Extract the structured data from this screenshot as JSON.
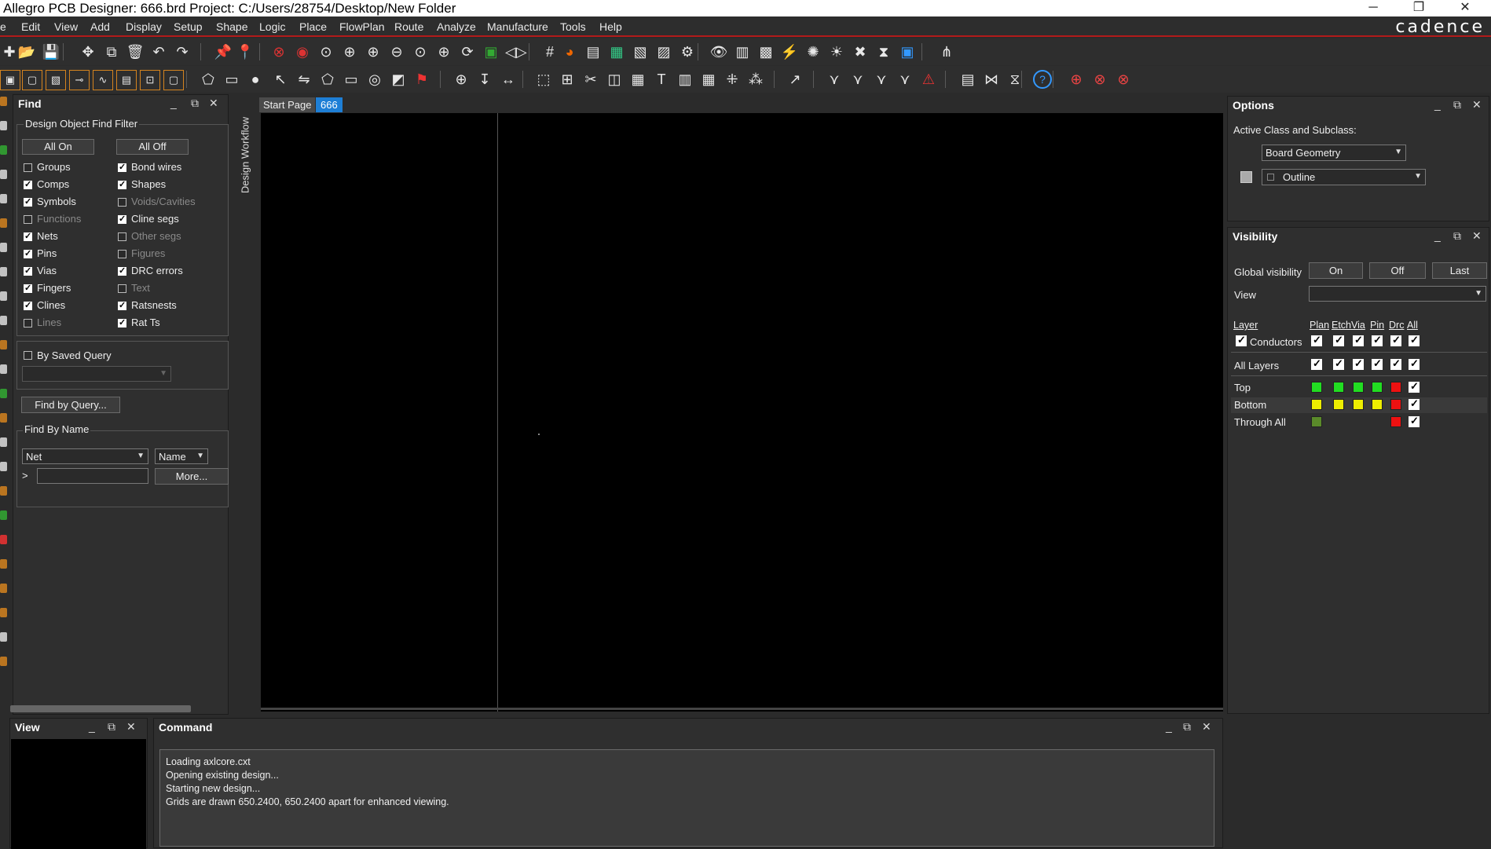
{
  "window": {
    "title": "Allegro PCB Designer: 666.brd  Project: C:/Users/28754/Desktop/New Folder",
    "controls": {
      "minimize": "─",
      "restore": "❐",
      "close": "✕"
    }
  },
  "menu": [
    "e",
    "Edit",
    "View",
    "Add",
    "Display",
    "Setup",
    "Shape",
    "Logic",
    "Place",
    "FlowPlan",
    "Route",
    "Analyze",
    "Manufacture",
    "Tools",
    "Help"
  ],
  "brand": "cadence",
  "find_panel": {
    "title": "Find",
    "group_title": "Design Object Find Filter",
    "all_on": "All On",
    "all_off": "All Off",
    "left_items": [
      {
        "label": "Groups",
        "checked": false,
        "dim": false
      },
      {
        "label": "Comps",
        "checked": true,
        "dim": false
      },
      {
        "label": "Symbols",
        "checked": true,
        "dim": false
      },
      {
        "label": "Functions",
        "checked": false,
        "dim": true
      },
      {
        "label": "Nets",
        "checked": true,
        "dim": false
      },
      {
        "label": "Pins",
        "checked": true,
        "dim": false
      },
      {
        "label": "Vias",
        "checked": true,
        "dim": false
      },
      {
        "label": "Fingers",
        "checked": true,
        "dim": false
      },
      {
        "label": "Clines",
        "checked": true,
        "dim": false
      },
      {
        "label": "Lines",
        "checked": false,
        "dim": true
      }
    ],
    "right_items": [
      {
        "label": "Bond wires",
        "checked": true,
        "dim": false
      },
      {
        "label": "Shapes",
        "checked": true,
        "dim": false
      },
      {
        "label": "Voids/Cavities",
        "checked": false,
        "dim": true
      },
      {
        "label": "Cline segs",
        "checked": true,
        "dim": false
      },
      {
        "label": "Other segs",
        "checked": false,
        "dim": true
      },
      {
        "label": "Figures",
        "checked": false,
        "dim": true
      },
      {
        "label": "DRC errors",
        "checked": true,
        "dim": false
      },
      {
        "label": "Text",
        "checked": false,
        "dim": true
      },
      {
        "label": "Ratsnests",
        "checked": true,
        "dim": false
      },
      {
        "label": "Rat Ts",
        "checked": true,
        "dim": false
      }
    ],
    "saved_query_label": "By Saved Query",
    "find_by_query": "Find by Query...",
    "find_by_name_title": "Find By Name",
    "name_type": "Net",
    "name_mode": "Name",
    "prompt": ">",
    "more": "More..."
  },
  "side_tab": "Design Workflow",
  "doc_tabs": [
    {
      "label": "Start Page",
      "active": false
    },
    {
      "label": "666",
      "active": true
    }
  ],
  "options_panel": {
    "title": "Options",
    "active_class_label": "Active Class and Subclass:",
    "class_value": "Board Geometry",
    "subclass_value": "Outline"
  },
  "visibility_panel": {
    "title": "Visibility",
    "global_label": "Global visibility",
    "on": "On",
    "off": "Off",
    "last": "Last",
    "view_label": "View",
    "view_value": "",
    "columns": [
      "Layer",
      "Plan",
      "Etch",
      "Via",
      "Pin",
      "Drc",
      "All"
    ],
    "conductors_label": "Conductors",
    "all_layers_label": "All Layers",
    "layers": [
      {
        "name": "Top",
        "colors": [
          "#22dd22",
          "#22dd22",
          "#22dd22",
          "#22dd22",
          "#ee1111"
        ]
      },
      {
        "name": "Bottom",
        "colors": [
          "#eeee00",
          "#eeee00",
          "#eeee00",
          "#eeee00",
          "#ee1111"
        ]
      },
      {
        "name": "Through All",
        "colors": [
          "#5a8a2a",
          "",
          "",
          "",
          "#ee1111"
        ]
      }
    ]
  },
  "view_panel": {
    "title": "View"
  },
  "command_panel": {
    "title": "Command",
    "lines": [
      "Loading axlcore.cxt",
      "Opening existing design...",
      "Starting new design...",
      "Grids are drawn 650.2400, 650.2400 apart for enhanced viewing."
    ]
  },
  "toolbar_row1_icons": [
    "new-icon",
    "open-icon",
    "save-icon",
    "move-icon",
    "copy-icon",
    "delete-icon",
    "undo-icon",
    "redo-icon",
    "pin-icon",
    "unpin-icon",
    "drc-icon",
    "layer-icon",
    "zoom-fit-icon",
    "zoom-points-icon",
    "zoom-in-icon",
    "zoom-out-icon",
    "zoom-world-icon",
    "zoom-center-icon",
    "redraw-icon",
    "3d-icon",
    "flip-icon",
    "grid-icon",
    "color-icon",
    "shadow-icon",
    "layers-icon",
    "report-icon",
    "doc-icon",
    "settings-icon",
    "eye-icon",
    "props-icon",
    "package-icon",
    "route-icon",
    "light-icon",
    "sun-icon",
    "cross-icon",
    "hourglass-icon",
    "pcb-icon",
    "share-icon"
  ],
  "toolbar_row2_icons": [
    "select-icon",
    "comp-icon",
    "pick-icon",
    "line-icon",
    "wave-icon",
    "box-icon",
    "image-icon",
    "frame-icon",
    "add-shape-icon",
    "rect-icon",
    "circle-icon",
    "pointer-icon",
    "edit-icon",
    "polygon-icon",
    "square-icon",
    "ring-icon",
    "fill-icon",
    "flag-icon",
    "search-icon",
    "dim-icon",
    "measure-icon",
    "place-icon",
    "group-icon",
    "cut-icon",
    "camera-icon",
    "ref-icon",
    "text-icon",
    "table-icon",
    "chip-icon",
    "pattern-icon",
    "matrix-icon",
    "connect-icon",
    "sw1-icon",
    "sw2-icon",
    "sw3-icon",
    "sw4-icon",
    "warn-icon",
    "report2-icon",
    "bowtie-icon",
    "tuner-icon",
    "help-icon",
    "add-net-icon",
    "net2-icon",
    "net3-icon"
  ]
}
